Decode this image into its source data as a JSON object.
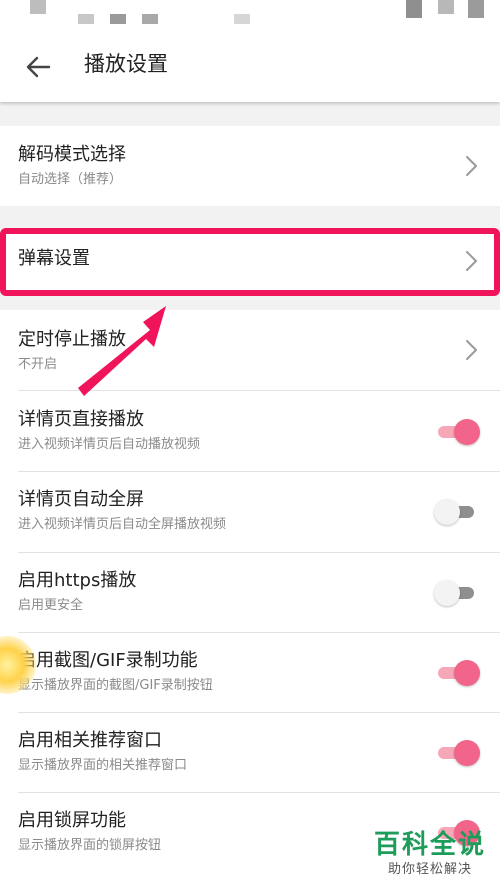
{
  "header": {
    "title": "播放设置",
    "back_icon": "arrow-left-icon"
  },
  "colors": {
    "accent": "#f2648a",
    "highlight": "#f0145a",
    "watermark": "#1e9c5a"
  },
  "settings": {
    "decode": {
      "title": "解码模式选择",
      "subtitle": "自动选择（推荐）"
    },
    "danmaku": {
      "title": "弹幕设置"
    },
    "timer": {
      "title": "定时停止播放",
      "subtitle": "不开启"
    },
    "detail_autoplay": {
      "title": "详情页直接播放",
      "subtitle": "进入视频详情页后自动播放视频",
      "enabled": true
    },
    "detail_fullscreen": {
      "title": "详情页自动全屏",
      "subtitle": "进入视频详情页后自动全屏播放视频",
      "enabled": false
    },
    "https": {
      "title": "启用https播放",
      "subtitle": "启用更安全",
      "enabled": false
    },
    "gif": {
      "title": "启用截图/GIF录制功能",
      "subtitle": "显示播放界面的截图/GIF录制按钮",
      "enabled": true
    },
    "recommend": {
      "title": "启用相关推荐窗口",
      "subtitle": "显示播放界面的相关推荐窗口",
      "enabled": true
    },
    "lockscreen": {
      "title": "启用锁屏功能",
      "subtitle": "显示播放界面的锁屏按钮",
      "enabled": true
    }
  },
  "watermark": {
    "brand": "百科全说",
    "slogan": "助你轻松解决"
  }
}
